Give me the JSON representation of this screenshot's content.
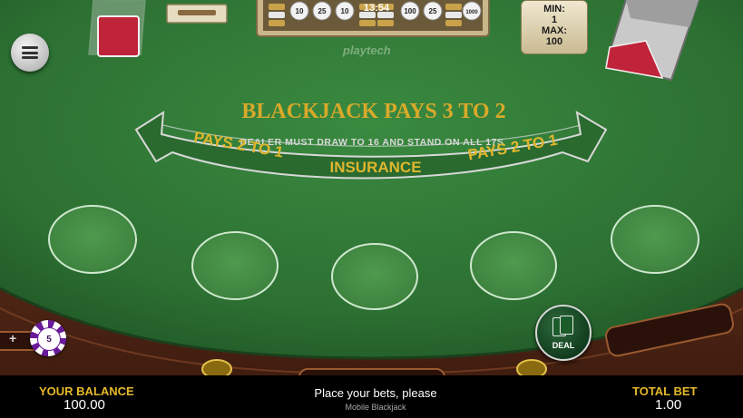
{
  "clock": "13:54",
  "provider": "playtech",
  "table_limits": {
    "min_label": "MIN:",
    "min_value": "1",
    "max_label": "MAX:",
    "max_value": "100"
  },
  "table_text": {
    "headline": "BLACKJACK PAYS 3 TO 2",
    "dealer_rule": "DEALER MUST DRAW TO 16 AND STAND ON ALL 17S",
    "left_payout": "PAYS 2 TO 1",
    "insurance": "INSURANCE",
    "right_payout": "PAYS 2 TO 1"
  },
  "chip_rack": [
    "10",
    "25",
    "10",
    "100",
    "25",
    "1000"
  ],
  "betting_spots": 5,
  "selected_chip": {
    "value": "5",
    "color": "#6a1b9a"
  },
  "deal_button": {
    "label": "DEAL"
  },
  "footer": {
    "balance_label": "YOUR BALANCE",
    "balance_value": "100.00",
    "status": "Place your bets, please",
    "game_name": "Mobile Blackjack",
    "total_bet_label": "TOTAL BET",
    "total_bet_value": "1.00"
  },
  "colors": {
    "felt": "#2f7a35",
    "rail": "#5a2e1b",
    "gold_text": "#e5b92a",
    "banner": "#2a6a2f"
  }
}
